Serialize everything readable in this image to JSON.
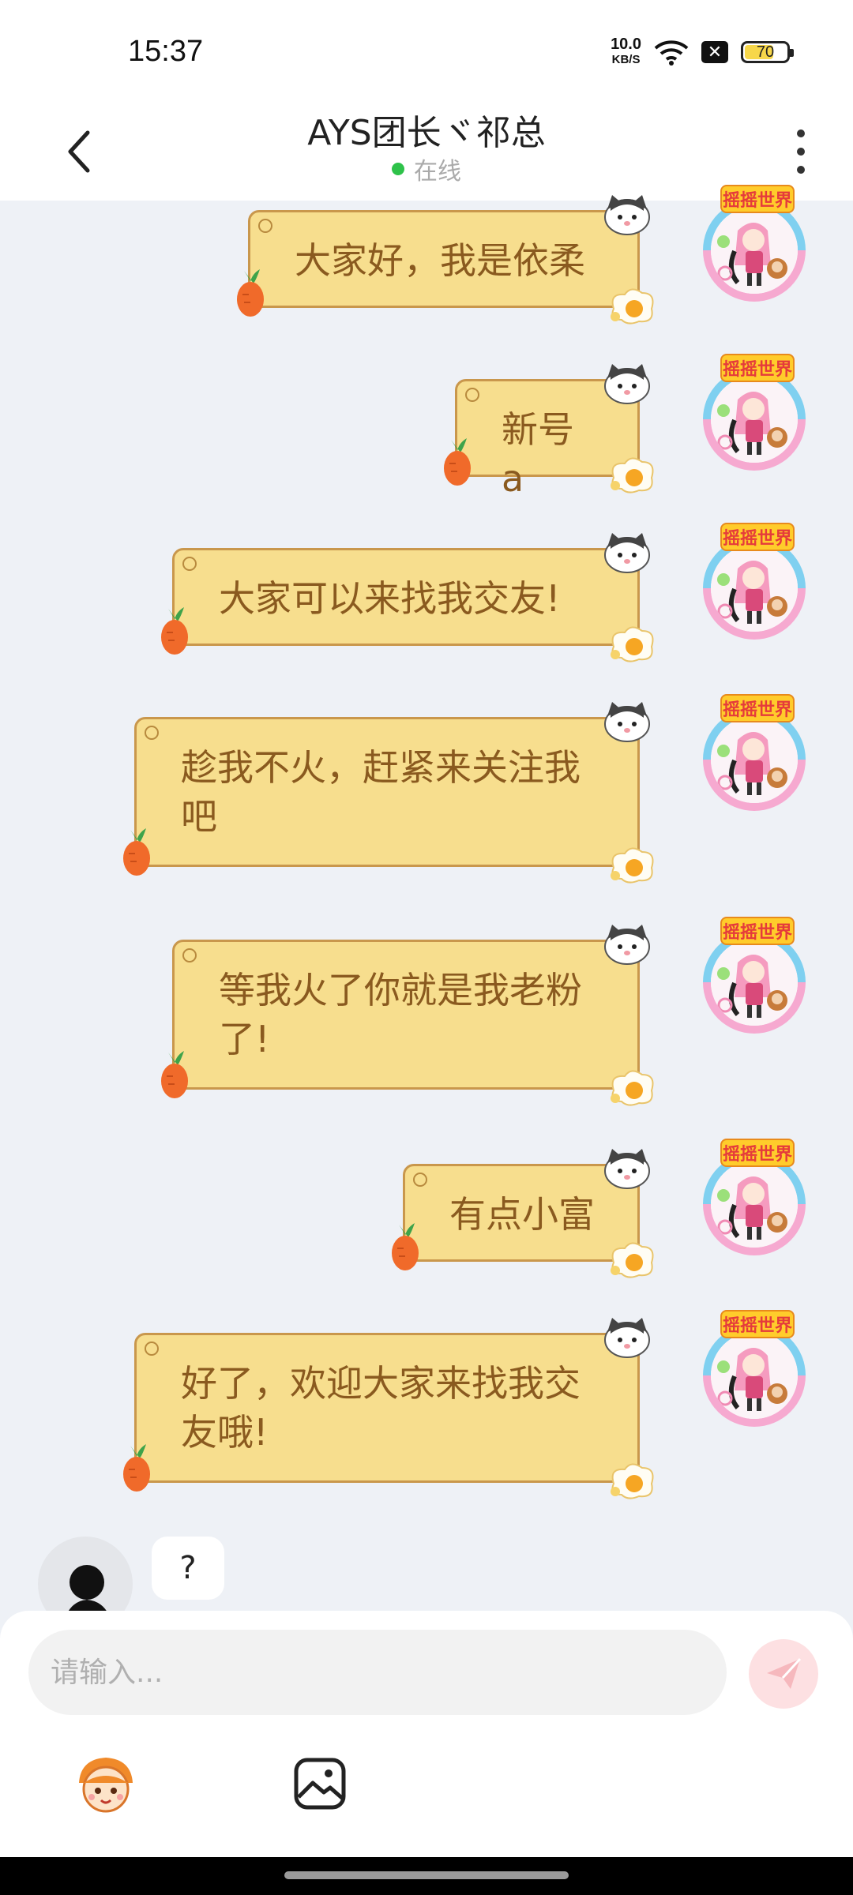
{
  "status_bar": {
    "time": "15:37",
    "net_speed_value": "10.0",
    "net_speed_unit": "KB/S",
    "battery_percent": "70",
    "battery_level": 0.7,
    "icons": [
      "wifi-icon",
      "sim-off-icon",
      "battery-icon"
    ]
  },
  "header": {
    "title": "AYS团长ヾ祁总",
    "status": "在线",
    "status_color": "#2ec24a",
    "icons": [
      "back-arrow-icon",
      "more-vertical-icon"
    ]
  },
  "messages": [
    {
      "text": "大家好，我是依柔"
    },
    {
      "text": "新号a"
    },
    {
      "text": "大家可以来找我交友!"
    },
    {
      "text": "趁我不火，赶紧来关注我吧"
    },
    {
      "text": "等我火了你就是我老粉了!"
    },
    {
      "text": "有点小富"
    },
    {
      "text": "好了，欢迎大家来找我交友哦!"
    }
  ],
  "avatar_badge": "摇摇世界",
  "incoming": {
    "text": "?"
  },
  "composer": {
    "placeholder": "请输入...",
    "icons": [
      "send-icon",
      "emoji-mascot-icon",
      "image-icon"
    ]
  },
  "colors": {
    "bubble_fill": "#f7de8e",
    "bubble_border": "#c9974c",
    "bubble_text": "#8a5a1f",
    "chat_background": "#eef1f6",
    "send_button": "#fde0e2"
  }
}
